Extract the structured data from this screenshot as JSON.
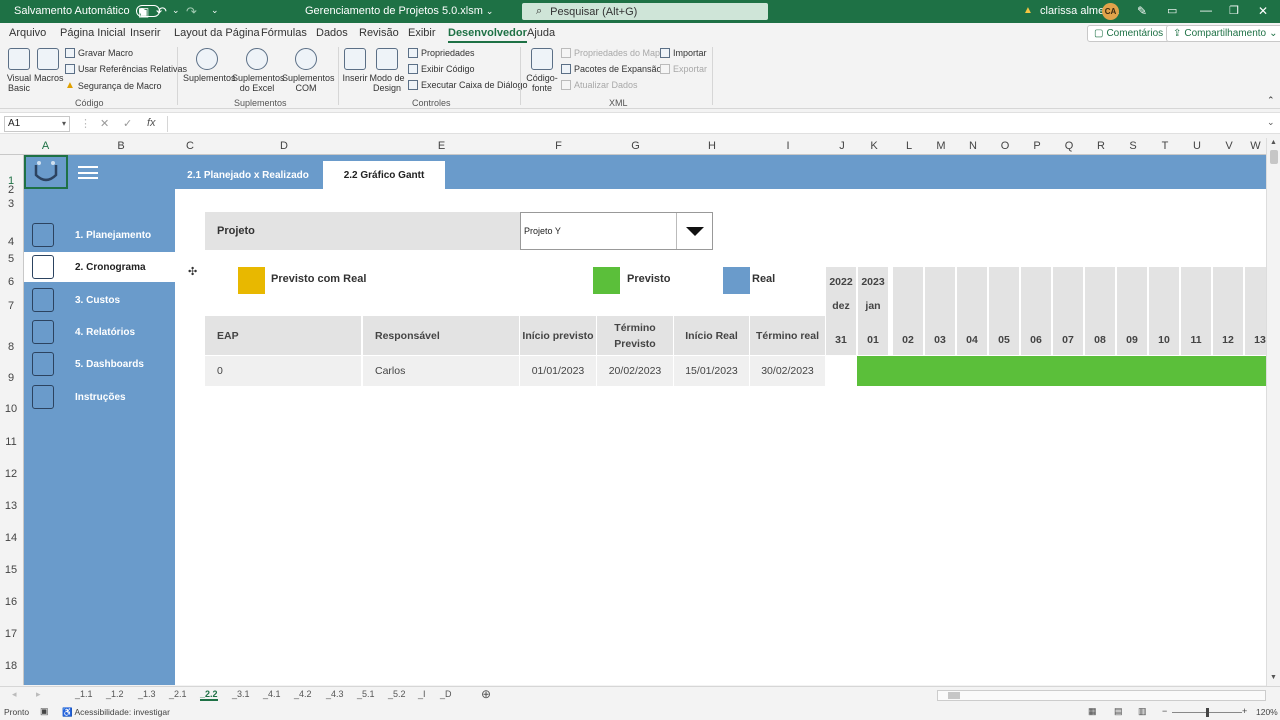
{
  "titlebar": {
    "autosave_label": "Salvamento Automático",
    "file_name": "Gerenciamento de Projetos 5.0.xlsm",
    "search_placeholder": "Pesquisar (Alt+G)",
    "user_name": "clarissa almeida",
    "user_initials": "CA"
  },
  "menu": {
    "tabs": [
      "Arquivo",
      "Página Inicial",
      "Inserir",
      "Layout da Página",
      "Fórmulas",
      "Dados",
      "Revisão",
      "Exibir",
      "Desenvolvedor",
      "Ajuda"
    ],
    "active_tab": "Desenvolvedor",
    "comments_label": "Comentários",
    "share_label": "Compartilhamento"
  },
  "ribbon": {
    "visual_basic": "Visual Basic",
    "macros": "Macros",
    "record_macro": "Gravar Macro",
    "relative_refs": "Usar Referências Relativas",
    "macro_security": "Segurança de Macro",
    "group_code": "Código",
    "addins": "Suplementos",
    "excel_addins": "Suplementos do Excel",
    "com_addins": "Suplementos COM",
    "group_addins": "Suplementos",
    "insert": "Inserir",
    "design_mode": "Modo de Design",
    "properties": "Propriedades",
    "view_code": "Exibir Código",
    "run_dialog": "Executar Caixa de Diálogo",
    "group_controls": "Controles",
    "source": "Código-fonte",
    "map_properties": "Propriedades do Mapa",
    "expansion_packs": "Pacotes de Expansão",
    "refresh_data": "Atualizar Dados",
    "import": "Importar",
    "export": "Exportar",
    "group_xml": "XML"
  },
  "formula_bar": {
    "name_box": "A1",
    "fx_label": "fx",
    "cancel_glyph": "✕",
    "enter_glyph": "✓"
  },
  "columns": [
    "A",
    "B",
    "C",
    "D",
    "E",
    "F",
    "G",
    "H",
    "I",
    "J",
    "K",
    "L",
    "M",
    "N",
    "O",
    "P",
    "Q",
    "R",
    "S",
    "T",
    "U",
    "V",
    "W"
  ],
  "rows": [
    "1",
    "2",
    "3",
    "4",
    "5",
    "6",
    "7",
    "8",
    "9",
    "10",
    "11",
    "12",
    "13",
    "14",
    "15",
    "16",
    "17",
    "18"
  ],
  "sidebar": {
    "items": [
      {
        "label": "1. Planejamento",
        "icon": "clipboard-pencil-icon"
      },
      {
        "label": "2. Cronograma",
        "icon": "calendar-check-icon"
      },
      {
        "label": "3. Custos",
        "icon": "document-dollar-icon"
      },
      {
        "label": "4. Relatórios",
        "icon": "report-icon"
      },
      {
        "label": "5. Dashboards",
        "icon": "dashboard-chart-icon"
      },
      {
        "label": "Instruções",
        "icon": "instructions-icon"
      }
    ],
    "active_index": 1
  },
  "subtabs": [
    "2.1 Planejado x Realizado",
    "2.2 Gráfico Gantt"
  ],
  "active_subtab": 1,
  "project": {
    "label": "Projeto",
    "selected": "Projeto Y"
  },
  "legend": [
    {
      "label": "Previsto com Real",
      "color": "#e8b800"
    },
    {
      "label": "Previsto",
      "color": "#5bbf3a"
    },
    {
      "label": "Real",
      "color": "#6a9bcb"
    }
  ],
  "table": {
    "headers": [
      "EAP",
      "Responsável",
      "Início previsto",
      "Término Previsto",
      "Início Real",
      "Término real"
    ],
    "rows": [
      [
        "0",
        "Carlos",
        "01/01/2023",
        "20/02/2023",
        "15/01/2023",
        "30/02/2023"
      ]
    ]
  },
  "gantt": {
    "columns": [
      {
        "year": "2022",
        "month": "dez",
        "day": "31"
      },
      {
        "year": "2023",
        "month": "jan",
        "day": "01"
      },
      {
        "year": "",
        "month": "",
        "day": "02"
      },
      {
        "year": "",
        "month": "",
        "day": "03"
      },
      {
        "year": "",
        "month": "",
        "day": "04"
      },
      {
        "year": "",
        "month": "",
        "day": "05"
      },
      {
        "year": "",
        "month": "",
        "day": "06"
      },
      {
        "year": "",
        "month": "",
        "day": "07"
      },
      {
        "year": "",
        "month": "",
        "day": "08"
      },
      {
        "year": "",
        "month": "",
        "day": "09"
      },
      {
        "year": "",
        "month": "",
        "day": "10"
      },
      {
        "year": "",
        "month": "",
        "day": "11"
      },
      {
        "year": "",
        "month": "",
        "day": "12"
      },
      {
        "year": "",
        "month": "",
        "day": "13"
      }
    ],
    "bar_color": "#5bbf3a"
  },
  "sheet_tabs": [
    "_1.1",
    "_1.2",
    "_1.3",
    "_2.1",
    "_2.2",
    "_3.1",
    "_4.1",
    "_4.2",
    "_4.3",
    "_5.1",
    "_5.2",
    "_I",
    "_D"
  ],
  "active_sheet": "_2.2",
  "status": {
    "ready": "Pronto",
    "accessibility": "Acessibilidade: investigar",
    "zoom": "120%"
  },
  "colors": {
    "excel_green": "#1e7145",
    "panel_blue": "#6a9bcb",
    "header_gray": "#e3e3e3"
  }
}
